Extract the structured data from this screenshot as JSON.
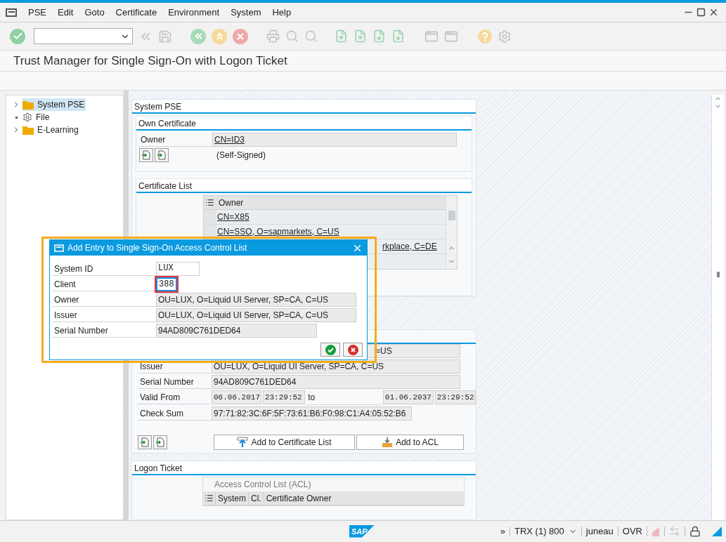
{
  "menu": [
    "PSE",
    "Edit",
    "Goto",
    "Certificate",
    "Environment",
    "System",
    "Help"
  ],
  "title": "Trust Manager for Single Sign-On with Logon Ticket",
  "tree": [
    {
      "label": "System PSE",
      "kind": "folder",
      "expanded": false,
      "selected": true
    },
    {
      "label": "File",
      "kind": "leaf",
      "selected": false
    },
    {
      "label": "E-Learning",
      "kind": "folder",
      "expanded": false,
      "selected": false
    }
  ],
  "system_pse": {
    "title": "System PSE",
    "own_certificate": {
      "title": "Own Certificate",
      "owner_label": "Owner",
      "owner": "CN=ID3",
      "signed": "(Self-Signed)"
    },
    "certificate_list": {
      "title": "Certificate List",
      "column": "Owner",
      "rows": [
        "CN=X85",
        "CN=SSO, O=sapmarkets, C=US",
        "rkplace, C=DE"
      ]
    }
  },
  "certificate": {
    "owner": "=US",
    "issuer_label": "Issuer",
    "issuer": "OU=LUX, O=Liquid UI Server, SP=CA, C=US",
    "serial_label": "Serial Number",
    "serial": "94AD809C761DED64",
    "valid_label": "Valid From",
    "valid_from_date": "06.06.2017",
    "valid_from_time": "23:29:52",
    "to_label": "to",
    "valid_to_date": "01.06.2037",
    "valid_to_time": "23:29:52",
    "checksum_label": "Check Sum",
    "checksum": "97:71:82:3C:6F:5F:73:61:B6:F0:98:C1:A4:05:52:B6",
    "buttons": [
      {
        "label": "Add to Certificate List",
        "kind": "list"
      },
      {
        "label": "Add to ACL",
        "kind": "acl"
      }
    ]
  },
  "logon_ticket": {
    "title": "Logon Ticket",
    "acl_title": "Access Control List (ACL)",
    "columns": [
      "System",
      "Cl.",
      "Certificate Owner"
    ]
  },
  "dialog": {
    "title": "Add Entry to Single Sign-On Access Control List",
    "fields": [
      {
        "label": "System ID",
        "value": "LUX",
        "kind": "long_input",
        "focused": false
      },
      {
        "label": "Client",
        "value": "388",
        "kind": "short_input",
        "focused": true
      },
      {
        "label": "Owner",
        "value": "OU=LUX, O=Liquid UI Server, SP=CA, C=US",
        "kind": "display"
      },
      {
        "label": "Issuer",
        "value": "OU=LUX, O=Liquid UI Server, SP=CA, C=US",
        "kind": "display"
      },
      {
        "label": "Serial Number",
        "value": "94AD809C761DED64",
        "kind": "serial"
      }
    ]
  },
  "status_bar": {
    "logo": "SAP",
    "expand": "»",
    "system": "TRX (1) 800",
    "user": "juneau",
    "mode": "OVR"
  }
}
